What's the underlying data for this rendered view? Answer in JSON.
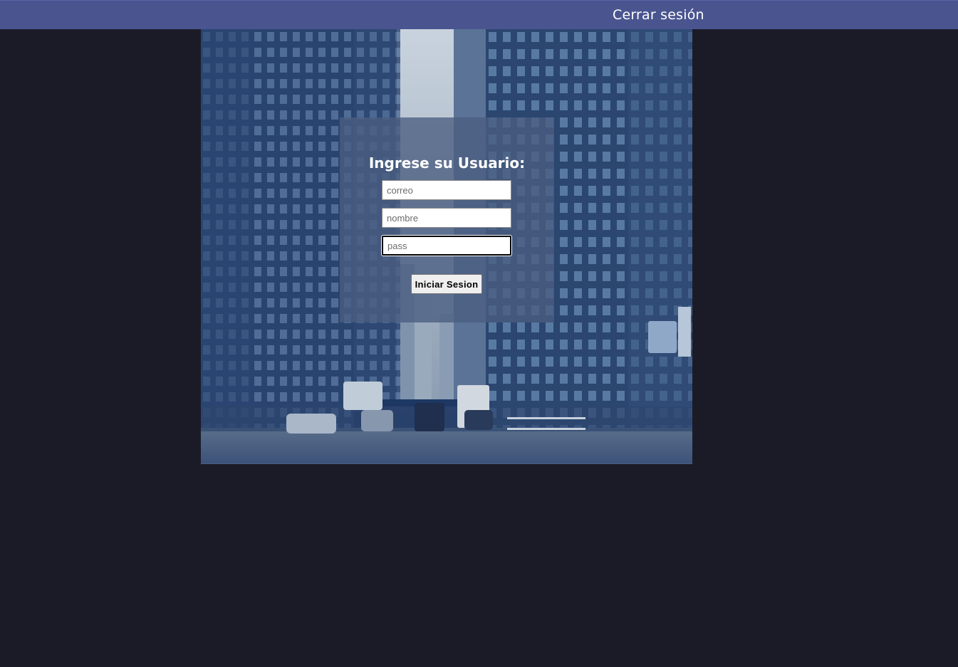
{
  "header": {
    "logout_label": "Cerrar sesión"
  },
  "hero": {
    "image_icon": "city-street-photo"
  },
  "login": {
    "title": "Ingrese su Usuario:",
    "email_placeholder": "correo",
    "email_value": "",
    "name_placeholder": "nombre",
    "name_value": "",
    "pass_placeholder": "pass",
    "pass_value": "",
    "submit_label": "Iniciar Sesion"
  },
  "colors": {
    "topbar": "#4a5590",
    "page_background": "#1b1b28",
    "panel": "#4a5e80"
  }
}
